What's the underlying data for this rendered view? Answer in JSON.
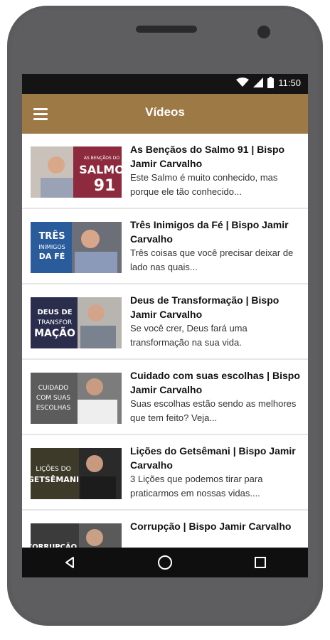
{
  "status_bar": {
    "time": "11:50",
    "icons": [
      "wifi-icon",
      "signal-icon",
      "battery-icon"
    ]
  },
  "app_bar": {
    "title": "Vídeos",
    "menu_icon": "hamburger-menu-icon"
  },
  "videos": [
    {
      "title": "As Bençãos do Salmo 91 | Bispo Jamir Carvalho",
      "description": "Este Salmo é muito conhecido, mas porque ele tão conhecido...",
      "thumb_text": [
        "AS BENÇÃOS DO",
        "SALMO",
        "91"
      ]
    },
    {
      "title": "Três Inimigos da Fé | Bispo Jamir Carvalho",
      "description": "Três coisas que você precisar deixar de lado nas quais...",
      "thumb_text": [
        "TRÊS",
        "INIMIGOS",
        "DA FÉ"
      ]
    },
    {
      "title": "Deus de Transformação | Bispo Jamir Carvalho",
      "description": "Se você crer, Deus fará uma transformação na sua vida.",
      "thumb_text": [
        "DEUS DE",
        "TRANSFOR",
        "MAÇÃO"
      ]
    },
    {
      "title": "Cuidado com suas escolhas | Bispo Jamir Carvalho",
      "description": "Suas escolhas estão sendo as melhores que tem feito? Veja...",
      "thumb_text": [
        "CUIDADO",
        "COM SUAS",
        "ESCOLHAS"
      ]
    },
    {
      "title": "Lições do Getsêmani | Bispo Jamir Carvalho",
      "description": "3 Lições que podemos tirar para praticarmos em nossas vidas....",
      "thumb_text": [
        "LIÇÕES DO",
        "GETSÊMANI"
      ]
    },
    {
      "title": "Corrupção | Bispo Jamir Carvalho",
      "description": "",
      "thumb_text": [
        "CORRUPÇÃO"
      ]
    }
  ],
  "nav_bar": {
    "buttons": [
      "back-icon",
      "home-icon",
      "recents-icon"
    ]
  },
  "colors": {
    "accent": "#9d7a45",
    "status_bar": "#141414",
    "nav_bar": "#0f0f0f"
  }
}
